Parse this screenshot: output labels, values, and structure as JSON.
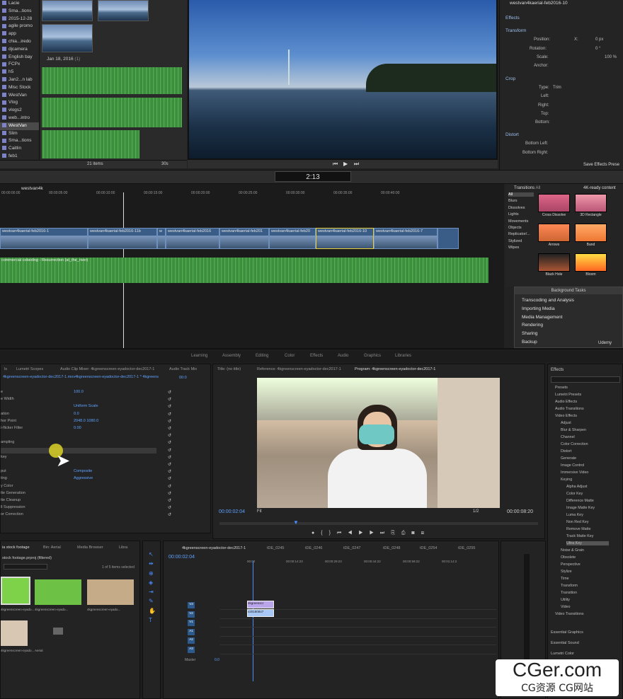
{
  "library": {
    "items": [
      "Lacie",
      "Sma...tions",
      "2015-12-28",
      "agile promo",
      "app",
      "chia...iredo",
      "djcamera",
      "English bay",
      "FCPx",
      "h5",
      "Jan2...n lab",
      "Misc Stock",
      "WestVan",
      "Vlog",
      "vlogs2",
      "web...intro",
      "WestVan",
      "Slim",
      "Sma...tions",
      "Caitlin",
      "feb1",
      "podcast"
    ],
    "selected_index": 16
  },
  "browser": {
    "date_header": "Jan 18, 2016",
    "date_count": "(1)",
    "items_count": "21 items",
    "duration": "30s"
  },
  "inspector": {
    "effects": "Effects",
    "transform": "Transform",
    "position": "Position:",
    "rotation": "Rotation:",
    "scale": "Scale:",
    "anchor": "Anchor:",
    "crop": "Crop",
    "type": "Type:",
    "type_val": "Trim",
    "left": "Left:",
    "right": "Right:",
    "top": "Top:",
    "bottom": "Bottom:",
    "distort": "Distort",
    "bottom_left": "Bottom Left:",
    "bottom_right": "Bottom Right:",
    "x": "X:",
    "y": "Y:",
    "zero_px": "0 px",
    "zero_deg": "0 °",
    "hundred": "100 %",
    "save": "Save Effects Prese",
    "clip_title": "westvan4kaerial-feb2016-10"
  },
  "timecode": "2:13",
  "timeline": {
    "project": "westvan4k",
    "ruler": [
      "00:00:00:00",
      "00:00:05:00",
      "00:00:10:00",
      "00:00:15:00",
      "00:00:20:00",
      "00:00:25:00",
      "00:00:30:00",
      "00:00:35:00",
      "00:00:40:00"
    ],
    "clips": [
      "westvan4kaerial-feb2016-1",
      "westvan4kaerial-feb2016-11b",
      "w",
      "westvan4kaerial-feb2016",
      "westvan4kaerial-feb201",
      "westvan4kaerial-feb20",
      "westvan4kaerial-feb2016-10",
      "westvan4kaerial-feb2016-7"
    ],
    "audio": "commercial cobeding - Resurrection (at_the_river)"
  },
  "transitions": {
    "title": "Transitions",
    "all": "All",
    "filter": "4K-ready content",
    "categories": [
      "All",
      "Blurs",
      "Dissolves",
      "Lights",
      "Movements",
      "Objects",
      "Replicator/...",
      "Stylized",
      "Wipes"
    ],
    "items": [
      "Cross Dissolve",
      "3D Rectangle",
      "Arrows",
      "Band",
      "Black Hole",
      "Bloom"
    ]
  },
  "background_tasks": {
    "title": "Background Tasks",
    "rows": [
      "Transcoding and Analysis",
      "Importing Media",
      "Media Management",
      "Rendering",
      "Sharing",
      "Backup"
    ],
    "udemy": "Udemy"
  },
  "workspaces": [
    "Learning",
    "Assembly",
    "Editing",
    "Color",
    "Effects",
    "Audio",
    "Graphics",
    "Libraries"
  ],
  "effect_controls": {
    "tabs": [
      "ls",
      "Lumetri Scopes",
      "Audio Clip Mixer: 4kgreenscreen-eyadoctor-dec2017-1",
      "Audio Track Mix"
    ],
    "source": "4kgreenscreen-eyadoctor-dec2017-1.mov",
    "seq": "4kgreenscreen-eyadoctor-dec2017-1 * 4kgreens",
    "playhead": "00:0",
    "rows": [
      [
        "e",
        "100.0"
      ],
      [
        "e Width",
        ""
      ],
      [
        "",
        "Uniform Scale"
      ],
      [
        "ation",
        "0.0"
      ],
      [
        "hor Point",
        "2048.0   1080.0"
      ],
      [
        "i-flicker Filter",
        "0.00"
      ],
      [
        "",
        ""
      ],
      [
        "ampling",
        ""
      ],
      [
        "",
        ""
      ],
      [
        "key",
        ""
      ],
      [
        "",
        ""
      ],
      [
        "put",
        "Composite"
      ],
      [
        "ting",
        "Aggressive"
      ],
      [
        "y Color",
        ""
      ],
      [
        "tte Generation",
        ""
      ],
      [
        "tte Cleanup",
        ""
      ],
      [
        "ll Suppression",
        ""
      ],
      [
        "or Correction",
        ""
      ]
    ]
  },
  "program": {
    "tabs": [
      "Title: (no title)",
      "Reference: 4kgreenscreen-eyadoctor-dec2017-1",
      "Program: 4kgreenscreen-eyadoctor-dec2017-1"
    ],
    "timecode": "00:00:02:04",
    "fit": "Fit",
    "ratio": "1/2",
    "duration": "00:00:08:20"
  },
  "effects_panel": {
    "title": "Effects",
    "items": [
      "Presets",
      "Lumetri Presets",
      "Audio Effects",
      "Audio Transitions",
      "Video Effects",
      "Adjust",
      "Blur & Sharpen",
      "Channel",
      "Color Correction",
      "Distort",
      "Generate",
      "Image Control",
      "Immersive Video",
      "Keying",
      "Alpha Adjust",
      "Color Key",
      "Difference Matte",
      "Image Matte Key",
      "Luma Key",
      "Non Red Key",
      "Remove Matte",
      "Track Matte Key",
      "Ultra Key",
      "Noise & Grain",
      "Obsolete",
      "Perspective",
      "Stylize",
      "Time",
      "Transform",
      "Transition",
      "Utility",
      "Video",
      "Video Transitions"
    ],
    "footer": [
      "Essential Graphics",
      "Essential Sound",
      "Lumetri Color"
    ]
  },
  "project": {
    "tabs": [
      "ia stock footage",
      "Bin: Aerial",
      "Media Browser",
      "Libra"
    ],
    "name": "stock footage.prproj (filtered)",
    "selected": "1 of 5 items selected",
    "items": [
      "4kgreenscreen-eyado...",
      "4kgreenscreen-eyado...",
      "4kgreenscreen-eyado...",
      "4kgreenscreen-eyado...",
      "Aerial"
    ],
    "durs": [
      "8:20",
      "",
      "",
      "8:11",
      "5 items"
    ]
  },
  "sequence": {
    "tabs": [
      "4kgreenscreen-eyadoctor-dec2017-1",
      "tDE_0245",
      "tDE_0246",
      "tDE_0247",
      "tDE_0248",
      "tDE_0254",
      "tDE_0255"
    ],
    "timecode": "00:00:02:04",
    "ruler": [
      "00:00",
      "00:00:14:23",
      "00:00:29:23",
      "00:00:44:22",
      "00:00:59:22",
      "00:01:14:2"
    ],
    "tracks": [
      "V3",
      "V2",
      "V1",
      "A1",
      "A2",
      "A3"
    ],
    "master": "Master",
    "master_val": "0.0",
    "clip_a": "4kgreenscr",
    "clip_b": "v20180847"
  },
  "watermark": {
    "big": "CGer.com",
    "small": "CG资源 CG网站"
  }
}
